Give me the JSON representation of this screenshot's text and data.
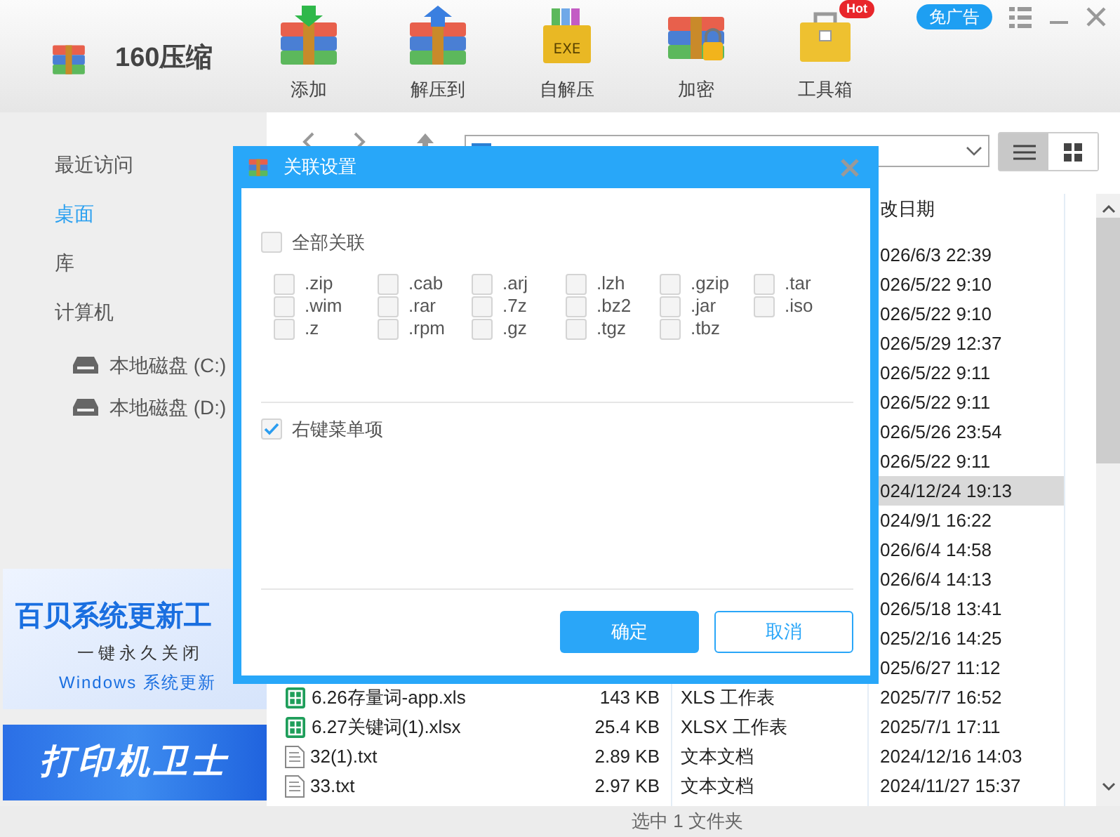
{
  "app": {
    "title": "160压缩"
  },
  "toolbar": [
    {
      "kind": "add",
      "label": "添加"
    },
    {
      "kind": "extract",
      "label": "解压到"
    },
    {
      "kind": "sfx",
      "label": "自解压",
      "icon_text": "EXE"
    },
    {
      "kind": "encrypt",
      "label": "加密"
    },
    {
      "kind": "toolbox",
      "label": "工具箱",
      "badge": "Hot"
    }
  ],
  "ad_free_button": "免广告",
  "sidebar": {
    "items": [
      {
        "label": "最近访问",
        "selected": false
      },
      {
        "label": "桌面",
        "selected": true
      },
      {
        "label": "库",
        "selected": false
      },
      {
        "label": "计算机",
        "selected": false,
        "children": [
          {
            "label": "本地磁盘 (C:)",
            "selected": false
          },
          {
            "label": "本地磁盘 (D:)",
            "selected": false
          }
        ]
      }
    ]
  },
  "ads": [
    {
      "kind": "light",
      "lines": [
        "百贝系统更新工",
        "一键永久关闭",
        "Windows 系统更新"
      ]
    },
    {
      "kind": "dark",
      "lines": [
        "打印机卫士"
      ]
    }
  ],
  "view_toggle": [
    {
      "kind": "list",
      "selected": true
    },
    {
      "kind": "grid",
      "selected": false
    }
  ],
  "file_list": {
    "date_header": "改日期",
    "rows": [
      {
        "modified": "026/6/3 22:39",
        "selected": false
      },
      {
        "modified": "026/5/22 9:10",
        "selected": false
      },
      {
        "modified": "026/5/22 9:10",
        "selected": false
      },
      {
        "modified": "026/5/29 12:37",
        "selected": false
      },
      {
        "modified": "026/5/22 9:11",
        "selected": false
      },
      {
        "modified": "026/5/22 9:11",
        "selected": false
      },
      {
        "modified": "026/5/26 23:54",
        "selected": false
      },
      {
        "modified": "026/5/22 9:11",
        "selected": false
      },
      {
        "modified": "024/12/24 19:13",
        "selected": true
      },
      {
        "modified": "024/9/1 16:22",
        "selected": false
      },
      {
        "modified": "026/6/4 14:58",
        "selected": false
      },
      {
        "modified": "026/6/4 14:13",
        "selected": false
      },
      {
        "modified": "026/5/18 13:41",
        "selected": false
      },
      {
        "modified": "025/2/16 14:25",
        "selected": false
      },
      {
        "modified": "025/6/27 11:12",
        "selected": false
      },
      {
        "kind": "sheet",
        "name": "6.26存量词-app.xls",
        "size": "143 KB",
        "type": "XLS 工作表",
        "modified": "2025/7/7 16:52",
        "selected": false
      },
      {
        "kind": "sheet",
        "name": "6.27关键词(1).xlsx",
        "size": "25.4 KB",
        "type": "XLSX 工作表",
        "modified": "2025/7/1 17:11",
        "selected": false
      },
      {
        "kind": "text",
        "name": "32(1).txt",
        "size": "2.89 KB",
        "type": "文本文档",
        "modified": "2024/12/16 14:03",
        "selected": false
      },
      {
        "kind": "text",
        "name": "33.txt",
        "size": "2.97 KB",
        "type": "文本文档",
        "modified": "2024/11/27 15:37",
        "selected": false
      }
    ]
  },
  "status_bar": "选中 1 文件夹",
  "dialog": {
    "title": "关联设置",
    "select_all": {
      "label": "全部关联",
      "checked": false
    },
    "extensions": [
      {
        "label": ".zip",
        "checked": false
      },
      {
        "label": ".cab",
        "checked": false
      },
      {
        "label": ".arj",
        "checked": false
      },
      {
        "label": ".lzh",
        "checked": false
      },
      {
        "label": ".gzip",
        "checked": false
      },
      {
        "label": ".tar",
        "checked": false
      },
      {
        "label": ".wim",
        "checked": false
      },
      {
        "label": ".rar",
        "checked": false
      },
      {
        "label": ".7z",
        "checked": false
      },
      {
        "label": ".bz2",
        "checked": false
      },
      {
        "label": ".jar",
        "checked": false
      },
      {
        "label": ".iso",
        "checked": false
      },
      {
        "label": ".z",
        "checked": false
      },
      {
        "label": ".rpm",
        "checked": false
      },
      {
        "label": ".gz",
        "checked": false
      },
      {
        "label": ".tgz",
        "checked": false
      },
      {
        "label": ".tbz",
        "checked": false
      }
    ],
    "context_menu": {
      "label": "右键菜单项",
      "checked": true
    },
    "buttons": [
      {
        "kind": "primary",
        "label": "确定"
      },
      {
        "kind": "secondary",
        "label": "取消"
      }
    ]
  }
}
